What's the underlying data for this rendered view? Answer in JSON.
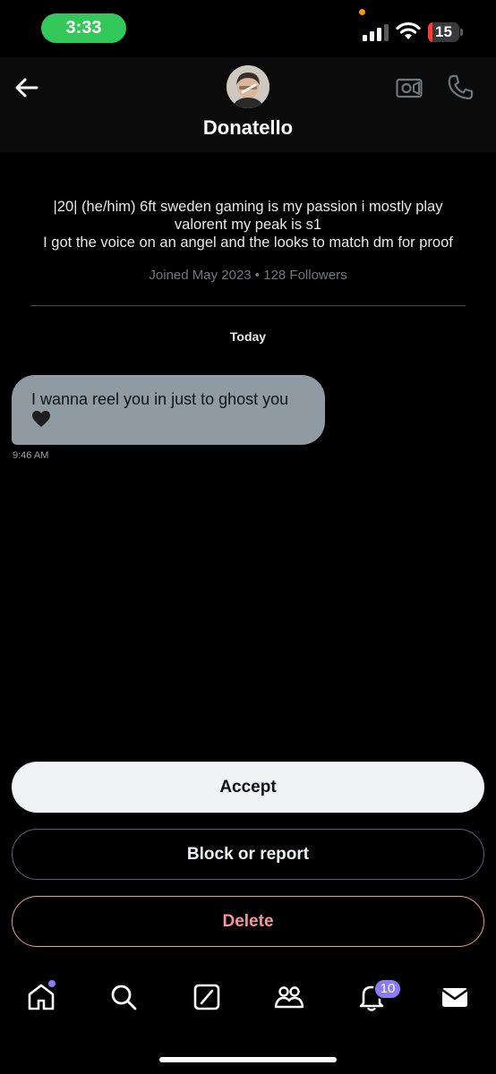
{
  "status_bar": {
    "time": "3:33",
    "battery_level": "15",
    "battery_fraction": 0.15,
    "signal_icon": "cellular-signal-icon",
    "wifi_icon": "wifi-icon"
  },
  "header": {
    "back_icon": "arrow-left-icon",
    "name": "Donatello",
    "video_icon": "video-camera-icon",
    "call_icon": "phone-icon"
  },
  "profile": {
    "bio_lines": [
      "|20| (he/him) 6ft sweden gaming is my passion i mostly play",
      "valorent my peak is s1",
      "I got the voice on an angel and the looks to match dm for proof"
    ],
    "joined": "Joined May 2023 • 128 Followers"
  },
  "conversation": {
    "day_label": "Today",
    "messages": [
      {
        "text": "I wanna reel you in just to ghost you",
        "emoji": "black-heart",
        "time": "9:46 AM"
      }
    ]
  },
  "actions": {
    "accept_label": "Accept",
    "block_label": "Block or report",
    "delete_label": "Delete"
  },
  "bottom_nav": {
    "items": [
      "home-icon",
      "search-icon",
      "grok-icon",
      "communities-icon",
      "notifications-icon",
      "messages-icon"
    ],
    "notifications_badge": "10"
  },
  "colors": {
    "status_time_pill": "#34c759",
    "bubble_bg": "#8f9aa3",
    "accept_bg": "#eff3f4",
    "delete_red": "#f4949d",
    "badge_purple": "#8b7cf6",
    "battery_red": "#ff3b30"
  }
}
